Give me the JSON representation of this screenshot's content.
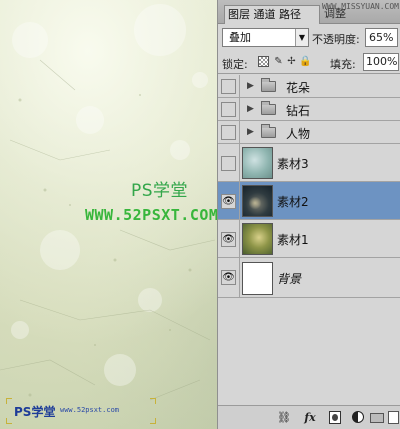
{
  "canvas": {
    "watermark_ps": "PS学堂",
    "watermark_url": "WWW.52PSXT.COM",
    "watermark_bottom_ps": "PS学堂",
    "watermark_bottom_url": "www.52psxt.com"
  },
  "panel": {
    "tabs": [
      {
        "label": "图层 通道 路径",
        "active": true
      },
      {
        "label": "调整",
        "active": false
      }
    ],
    "site_tag": "WWW.MISSYUAN.COM",
    "blend_mode": "叠加",
    "opacity_label": "不透明度:",
    "opacity_value": "65%",
    "lock_label": "锁定:",
    "fill_label": "填充:",
    "fill_value": "100%",
    "layers": [
      {
        "name": "花朵",
        "type": "group",
        "visible": false,
        "selected": false
      },
      {
        "name": "钻石",
        "type": "group",
        "visible": false,
        "selected": false
      },
      {
        "name": "人物",
        "type": "group",
        "visible": false,
        "selected": false
      },
      {
        "name": "素材3",
        "type": "image",
        "visible": false,
        "selected": false
      },
      {
        "name": "素材2",
        "type": "image",
        "visible": true,
        "selected": true
      },
      {
        "name": "素材1",
        "type": "image",
        "visible": true,
        "selected": false
      },
      {
        "name": "背景",
        "type": "background",
        "visible": true,
        "selected": false
      }
    ],
    "icons": {
      "eye": "eye-icon",
      "link": "link-layers-icon",
      "fx": "fx",
      "mask": "add-mask-icon",
      "adjust": "adjustment-layer-icon",
      "group": "new-group-icon",
      "new": "new-layer-icon"
    }
  }
}
